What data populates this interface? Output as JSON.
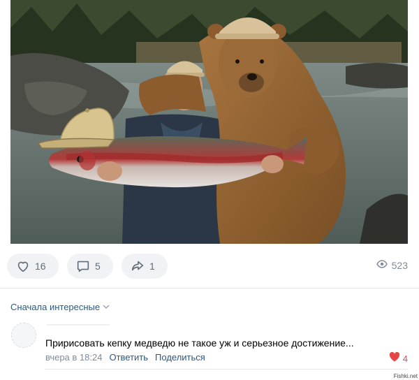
{
  "post": {
    "image_alt": "Man and bear holding a large trout by a river",
    "actions": {
      "likes": "16",
      "comments": "5",
      "shares": "1"
    },
    "views": "523",
    "icons": {
      "like": "heart-outline-icon",
      "comment": "speech-bubble-icon",
      "share": "share-arrow-icon",
      "views": "eye-icon"
    }
  },
  "comments_section": {
    "sort_label": "Сначала интересные",
    "sort_icon": "chevron-down-icon",
    "items": [
      {
        "text": "Пририсовать кепку медведю не такое уж и серьезное достижение...",
        "time": "вчера в 18:24",
        "reply_label": "Ответить",
        "share_label": "Поделиться",
        "likes": "4",
        "liked": true
      }
    ]
  },
  "watermark": "Fishki.net",
  "colors": {
    "link": "#2a5885",
    "muted": "#818c99",
    "like_red": "#e64646",
    "button_bg": "#f0f2f5"
  }
}
